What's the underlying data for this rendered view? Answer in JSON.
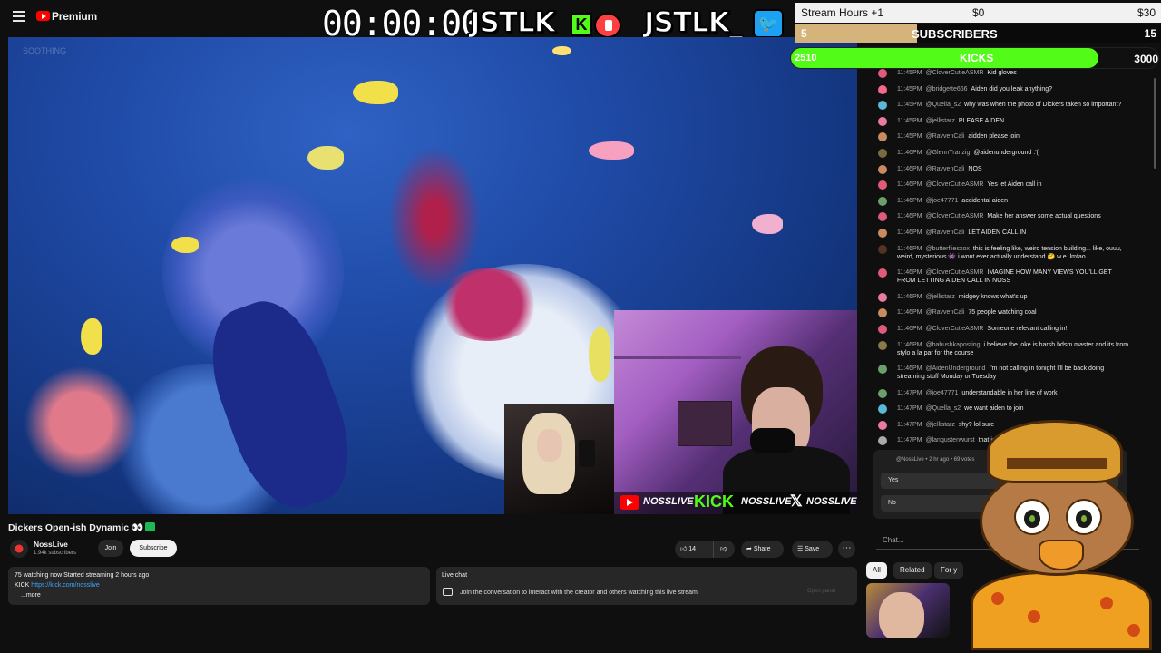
{
  "header": {
    "premium_label": "Premium",
    "timer": "00:00:00",
    "brand_left": "JSTLK",
    "kick_badge": "K",
    "brand_right": "JSTLK_"
  },
  "overlays": {
    "hours": {
      "label": "Stream Hours +1",
      "mid": "$0",
      "right": "$30"
    },
    "subscribers": {
      "current": "5",
      "label": "SUBSCRIBERS",
      "goal": "15",
      "progress": 0.333
    },
    "kicks": {
      "current": "2510",
      "label": "KICKS",
      "goal": "3000",
      "progress": 0.837
    },
    "colors": {
      "kick_green": "#53fc18",
      "subs_gold": "#d4b47a"
    }
  },
  "video": {
    "watermark": "SOOTHING",
    "socials": [
      {
        "icon": "youtube-icon",
        "handle": "NOSSLIVE"
      },
      {
        "icon": "kick-logo",
        "brand": "KICK",
        "handle": "NOSSLIVE"
      },
      {
        "icon": "x-icon",
        "handle": "NOSSLIVE"
      }
    ]
  },
  "meta": {
    "title": "Dickers Open-ish Dynamic 👀",
    "channel_name": "NossLive",
    "subscribers": "1.94k subscribers",
    "join_label": "Join",
    "subscribe_label": "Subscribe",
    "like_count": "14",
    "share_label": "Share",
    "save_label": "Save",
    "more_label": "⋯"
  },
  "description": {
    "stats": "75 watching now  Started streaming 2 hours ago",
    "kick_prefix": "KICK ",
    "kick_link": "https://kick.com/nosslive",
    "more": "...more"
  },
  "livechat_panel": {
    "title": "Live chat",
    "desc": "Join the conversation to interact with the creator and others watching this live stream.",
    "open_panel": "Open panel"
  },
  "chat": {
    "messages": [
      {
        "time": "11:45PM",
        "author": "@CloverCutieASMR",
        "text": "Kid gloves",
        "color": "#e05a7a"
      },
      {
        "time": "11:45PM",
        "author": "@bridgette666",
        "text": "Aiden did you leak anything?",
        "color": "#f06a8a"
      },
      {
        "time": "11:45PM",
        "author": "@Quella_s2",
        "text": "why was when the photo of Dickers taken so important?",
        "color": "#5ab7d6"
      },
      {
        "time": "11:45PM",
        "author": "@jellistarz",
        "text": "PLEASE AIDEN",
        "color": "#e87aa0"
      },
      {
        "time": "11:45PM",
        "author": "@RavvenCali",
        "text": "aidden please join",
        "color": "#c98a60"
      },
      {
        "time": "11:46PM",
        "author": "@GlennTranzig",
        "text": "@aidenunderground :'(",
        "color": "#7a6a40"
      },
      {
        "time": "11:46PM",
        "author": "@RavvenCali",
        "text": "NOS",
        "color": "#c98a60"
      },
      {
        "time": "11:46PM",
        "author": "@CloverCutieASMR",
        "text": "Yes let Aiden call in",
        "color": "#e05a7a"
      },
      {
        "time": "11:46PM",
        "author": "@joe47771",
        "text": "accidental aiden",
        "color": "#6aa06a"
      },
      {
        "time": "11:46PM",
        "author": "@CloverCutieASMR",
        "text": "Make her answer some actual questions",
        "color": "#e05a7a"
      },
      {
        "time": "11:46PM",
        "author": "@RavvenCali",
        "text": "LET AIDEN CALL IN",
        "color": "#c98a60"
      },
      {
        "time": "11:46PM",
        "author": "@butterfliesxox",
        "text": "this is feeling like, weird tension building... like, ouuu, weird, mysterious 👾 i wont ever actually understand 🤔 w.e. lmfao",
        "color": "#553322"
      },
      {
        "time": "11:46PM",
        "author": "@CloverCutieASMR",
        "text": "IMAGINE HOW MANY VIEWS YOU'LL GET FROM LETTING AIDEN CALL IN NOSS",
        "color": "#e05a7a"
      },
      {
        "time": "11:46PM",
        "author": "@jellistarz",
        "text": "midgey knows what's up",
        "color": "#e87aa0"
      },
      {
        "time": "11:46PM",
        "author": "@RavvenCali",
        "text": "75 people watching coal",
        "color": "#c98a60"
      },
      {
        "time": "11:46PM",
        "author": "@CloverCutieASMR",
        "text": "Someone relevant calling in!",
        "color": "#e05a7a"
      },
      {
        "time": "11:46PM",
        "author": "@babushkaposting",
        "text": "i believe the joke is harsh bdsm master and its from stylo a la par for the course",
        "color": "#8a7a4a"
      },
      {
        "time": "11:46PM",
        "author": "@AidenUnderground",
        "text": "I'm not calling in tonight I'll be back doing streaming stuff Monday or Tuesday",
        "color": "#6aa06a"
      },
      {
        "time": "11:47PM",
        "author": "@joe47771",
        "text": "understandable in her line of work",
        "color": "#6aa06a"
      },
      {
        "time": "11:47PM",
        "author": "@Quella_s2",
        "text": "we want aiden to join",
        "color": "#5ab7d6"
      },
      {
        "time": "11:47PM",
        "author": "@jellistarz",
        "text": "shy? lol sure",
        "color": "#e87aa0"
      },
      {
        "time": "11:47PM",
        "author": "@langustenwurst",
        "text": "that is h... bought the harsh bdsm thing",
        "color": "#aaaaaa"
      }
    ],
    "poll": {
      "author": "@NossLive • 2 hr ago • 69 votes",
      "options": [
        "Yes",
        "No"
      ]
    },
    "input_placeholder": "Chat...",
    "tabs": [
      "All",
      "Related",
      "For y"
    ]
  }
}
